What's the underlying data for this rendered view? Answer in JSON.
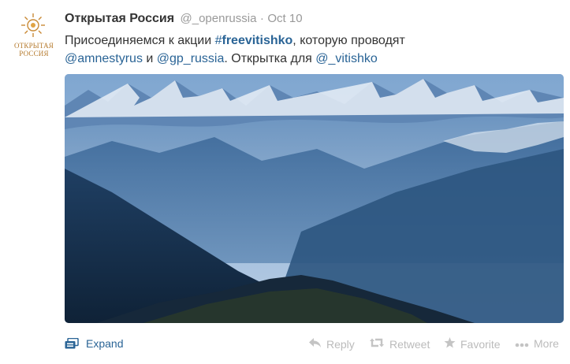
{
  "tweet": {
    "avatar_text_line1": "ОТКРЫТАЯ",
    "avatar_text_line2": "РОССИЯ",
    "fullname": "Открытая Россия",
    "username": "@_openrussia",
    "separator": "·",
    "time": "Oct 10",
    "text_part1": "Присоединяемся к акции ",
    "hashtag_symbol": "#",
    "hashtag": "freevitishko",
    "text_part2": ", которую проводят",
    "mention1": "@amnestyrus",
    "text_part3": " и ",
    "mention2": "@gp_russia",
    "text_part4": ". Открытка для ",
    "mention3": "@_vitishko"
  },
  "actions": {
    "expand": "Expand",
    "reply": "Reply",
    "retweet": "Retweet",
    "favorite": "Favorite",
    "more": "More"
  },
  "colors": {
    "link": "#2a6496",
    "muted": "#999999",
    "action_inactive": "#bbbbbb",
    "logo_gold": "#b57a2d"
  },
  "icons": [
    "logo-sun-icon",
    "expand-icon",
    "reply-icon",
    "retweet-icon",
    "favorite-icon",
    "more-icon"
  ]
}
